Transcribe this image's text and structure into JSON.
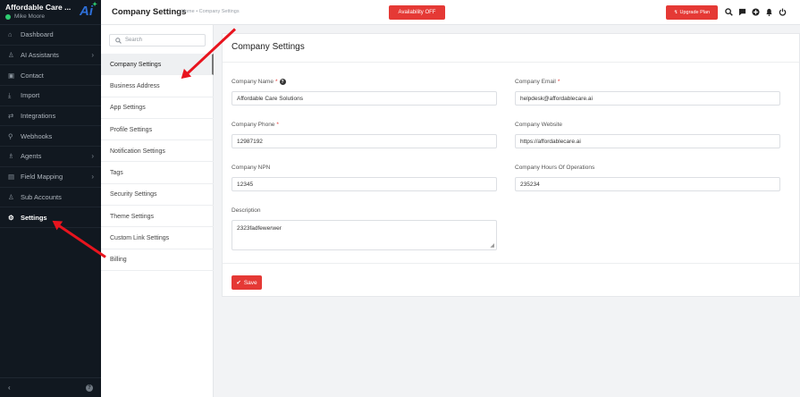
{
  "sidebar": {
    "brand_name": "Affordable Care ...",
    "user_name": "Mike Moore",
    "logo_text": "Ai",
    "items": [
      {
        "label": "Dashboard",
        "icon": "⌂",
        "has_chevron": false
      },
      {
        "label": "AI Assistants",
        "icon": "♙",
        "has_chevron": true
      },
      {
        "label": "Contact",
        "icon": "▣",
        "has_chevron": false
      },
      {
        "label": "Import",
        "icon": "⤓",
        "has_chevron": false
      },
      {
        "label": "Integrations",
        "icon": "⇄",
        "has_chevron": false
      },
      {
        "label": "Webhooks",
        "icon": "⚲",
        "has_chevron": false
      },
      {
        "label": "Agents",
        "icon": "♗",
        "has_chevron": true
      },
      {
        "label": "Field Mapping",
        "icon": "▤",
        "has_chevron": true
      },
      {
        "label": "Sub Accounts",
        "icon": "♙",
        "has_chevron": false
      },
      {
        "label": "Settings",
        "icon": "⚙",
        "has_chevron": false
      }
    ],
    "collapse_glyph": "‹",
    "help_glyph": "?"
  },
  "topbar": {
    "title": "Company Settings",
    "breadcrumb": "Home • Company Settings",
    "availability_label": "Availability OFF",
    "upgrade_label": "Upgrade Plan",
    "upgrade_glyph": "↯"
  },
  "submenu": {
    "search_placeholder": "Search",
    "items": [
      "Company Settings",
      "Business Address",
      "App Settings",
      "Profile Settings",
      "Notification Settings",
      "Tags",
      "Security Settings",
      "Theme Settings",
      "Custom Link Settings",
      "Billing"
    ]
  },
  "form": {
    "title": "Company Settings",
    "company_name": {
      "label": "Company Name",
      "value": "Affordable Care Solutions"
    },
    "company_email": {
      "label": "Company Email",
      "value": "helpdesk@affordablecare.ai"
    },
    "company_phone": {
      "label": "Company Phone",
      "value": "12987192"
    },
    "company_website": {
      "label": "Company Website",
      "value": "https://affordablecare.ai"
    },
    "company_npn": {
      "label": "Company NPN",
      "value": "12345"
    },
    "company_hours": {
      "label": "Company Hours Of Operations",
      "value": "235234"
    },
    "description": {
      "label": "Description",
      "value": "2323fadfewerwer"
    },
    "required_mark": "*",
    "save_label": "Save"
  },
  "colors": {
    "accent": "#e53935",
    "sidebar_bg": "#111820",
    "annotation_arrow": "#e8141e"
  }
}
